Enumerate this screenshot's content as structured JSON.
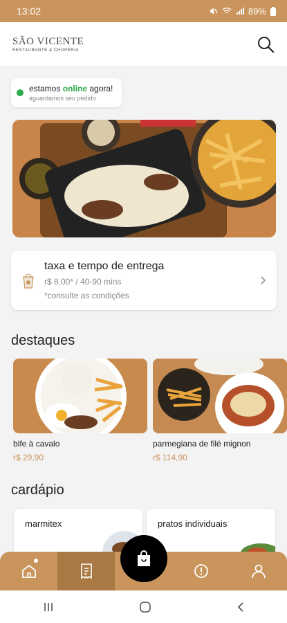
{
  "status_bar": {
    "time": "13:02",
    "battery": "89%"
  },
  "header": {
    "logo_name": "SÃO VICENTE",
    "logo_sub": "RESTAURANTE & CHOPERIA",
    "icons": {
      "search": "search-icon"
    }
  },
  "online": {
    "prefix": "estamos ",
    "highlight": "online",
    "suffix": " agora!",
    "sub": "aguardamos seu pedido"
  },
  "delivery": {
    "title": "taxa e tempo de entrega",
    "line1": "r$ 8,00* / 40-90 mins",
    "line2": "*consulte as condições"
  },
  "highlights": {
    "title": "destaques",
    "items": [
      {
        "name": "bife à cavalo",
        "price": "r$ 29,90"
      },
      {
        "name": "parmegiana de filé mignon",
        "price": "r$ 114,90"
      }
    ]
  },
  "menu": {
    "title": "cardápio",
    "items": [
      {
        "label": "marmitex"
      },
      {
        "label": "pratos individuais"
      }
    ]
  },
  "nav": {
    "items": [
      "home-icon",
      "orders-icon",
      "cart-icon",
      "info-icon",
      "profile-icon"
    ]
  },
  "colors": {
    "brand": "#c9955c",
    "brand_dark": "#a97944",
    "online_green": "#2bab4a"
  }
}
